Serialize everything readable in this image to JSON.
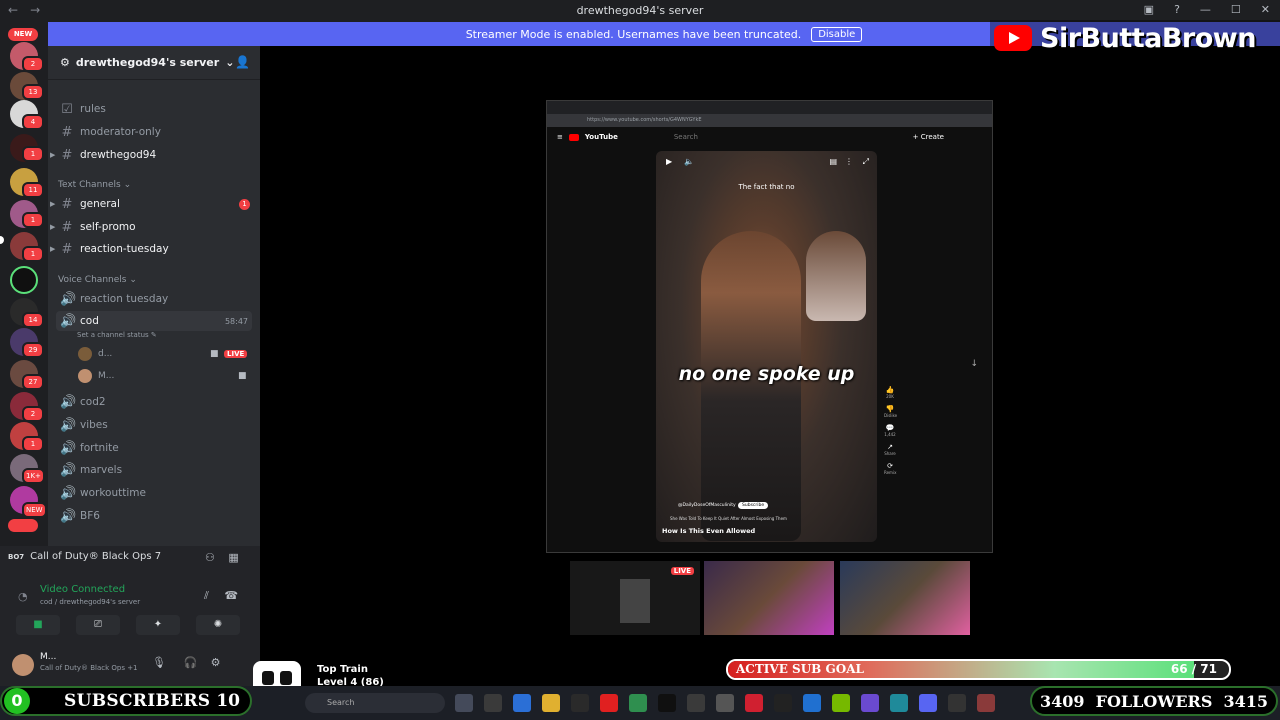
{
  "window": {
    "title": "drewthegod94's server"
  },
  "streamer_banner": {
    "text": "Streamer Mode is enabled. Usernames have been truncated.",
    "button": "Disable"
  },
  "overlay": {
    "channel_name": "SirButtaBrown"
  },
  "server_rail": {
    "badges": [
      "NEW",
      "2",
      "13",
      "4",
      "1",
      "11",
      "1",
      "1",
      "14",
      "29",
      "27",
      "2",
      "1",
      "1K+",
      "NEW"
    ]
  },
  "server": {
    "name": "drewthegod94's server"
  },
  "channels_top": [
    {
      "name": "rules"
    },
    {
      "name": "moderator-only"
    },
    {
      "name": "drewthegod94"
    }
  ],
  "text_category": "Text Channels",
  "text_channels": [
    {
      "name": "general",
      "unread": "1"
    },
    {
      "name": "self-promo"
    },
    {
      "name": "reaction-tuesday"
    }
  ],
  "voice_category": "Voice Channels",
  "voice_channels": {
    "reaction": "reaction tuesday",
    "cod": "cod",
    "cod_time": "58:47",
    "cod_status": "Set a channel status",
    "users": [
      {
        "name": "d...",
        "live": "LIVE"
      },
      {
        "name": "M..."
      }
    ],
    "others": [
      "cod2",
      "vibes",
      "fortnite",
      "marvels",
      "workouttime",
      "BF6"
    ]
  },
  "activity": {
    "game": "Call of Duty® Black Ops 7"
  },
  "voice_status": {
    "title": "Video Connected",
    "sub": "cod / drewthegod94's server"
  },
  "user": {
    "name": "M...",
    "status": "Call of Duty® Black Ops +1"
  },
  "browser": {
    "url": "https://www.youtube.com/shorts/G4WNYGYkE",
    "search_placeholder": "Search",
    "create": "+ Create"
  },
  "video": {
    "caption_top": "The fact that no",
    "caption_main": "no one spoke up",
    "channel": "@DailyDoseOfMasculinity",
    "subscribe": "Subscribe",
    "desc": "She Was Told To Keep It Quiet After Almost Exposing Them",
    "title": "How Is This Even Allowed",
    "actions": [
      "20K",
      "Dislike",
      "1,442",
      "Share",
      "Remix"
    ]
  },
  "thumbs": {
    "live": "LIVE"
  },
  "top_train": {
    "title": "Top Train",
    "level": "Level 4  (86)"
  },
  "sub_goal": {
    "label": "ACTIVE SUB GOAL",
    "current": 66,
    "target": 71,
    "text": "66 / 71"
  },
  "subscribers": {
    "count_left": "0",
    "label": "SUBSCRIBERS",
    "count": "10"
  },
  "followers": {
    "count_left": "3409",
    "label": "FOLLOWERS",
    "count": "3415"
  },
  "taskbar": {
    "search": "Search"
  },
  "colors": {
    "discord_blurple": "#5865f2",
    "live_red": "#f23f43",
    "voice_green": "#23a55a"
  }
}
